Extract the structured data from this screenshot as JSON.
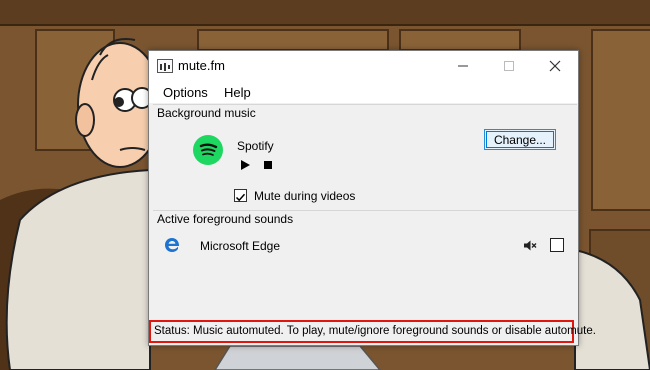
{
  "window": {
    "title": "mute.fm",
    "menu": [
      "Options",
      "Help"
    ]
  },
  "background_music": {
    "section_label": "Background music",
    "player_name": "Spotify",
    "player_icon": "spotify-icon",
    "change_button_label": "Change...",
    "mute_during_videos_label": "Mute during videos",
    "mute_during_videos_checked": true
  },
  "foreground": {
    "section_label": "Active foreground sounds",
    "items": [
      {
        "name": "Microsoft Edge",
        "icon": "edge-icon",
        "muted": true,
        "ignored": false
      }
    ]
  },
  "status": {
    "text": "Status: Music automuted. To play, mute/ignore foreground sounds or disable automute."
  },
  "colors": {
    "spotify": "#1ed760",
    "edge": "#1e73d2",
    "status_highlight": "#e0170f",
    "button_border": "#2a8ad4"
  }
}
